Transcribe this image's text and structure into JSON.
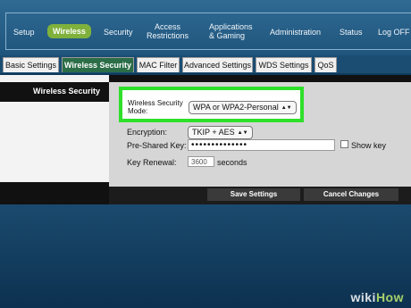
{
  "topnav": {
    "items": [
      {
        "label": "Setup"
      },
      {
        "label": "Wireless"
      },
      {
        "label": "Security"
      },
      {
        "label": "Access",
        "label2": "Restrictions"
      },
      {
        "label": "Applications",
        "label2": "& Gaming"
      },
      {
        "label": "Administration"
      },
      {
        "label": "Status"
      },
      {
        "label": "Log OFF"
      }
    ],
    "active": "Wireless"
  },
  "subtabs": {
    "items": [
      "Basic Settings",
      "Wireless Security",
      "MAC Filter",
      "Advanced Settings",
      "WDS Settings",
      "QoS"
    ],
    "active": "Wireless Security"
  },
  "section_title": "Wireless Security",
  "form": {
    "security_mode_label_line1": "Wireless Security",
    "security_mode_label_line2": "Mode:",
    "security_mode_value": "WPA or WPA2-Personal",
    "encryption_label": "Encryption:",
    "encryption_value": "TKIP + AES",
    "psk_label": "Pre-Shared Key:",
    "psk_value": "••••••••••••••",
    "show_key_label": "Show key",
    "show_key_checked": false,
    "renewal_label": "Key Renewal:",
    "renewal_value": "3600",
    "renewal_unit": "seconds"
  },
  "actions": {
    "save": "Save Settings",
    "cancel": "Cancel Changes"
  },
  "select_arrows": "▲▼",
  "watermark": {
    "part1": "wiki",
    "part2": "How"
  },
  "colors": {
    "accent_green": "#7fb13c",
    "highlight_green": "#2fe02a",
    "nav_blue": "#2f6a93",
    "active_tab": "#2b6d47"
  }
}
